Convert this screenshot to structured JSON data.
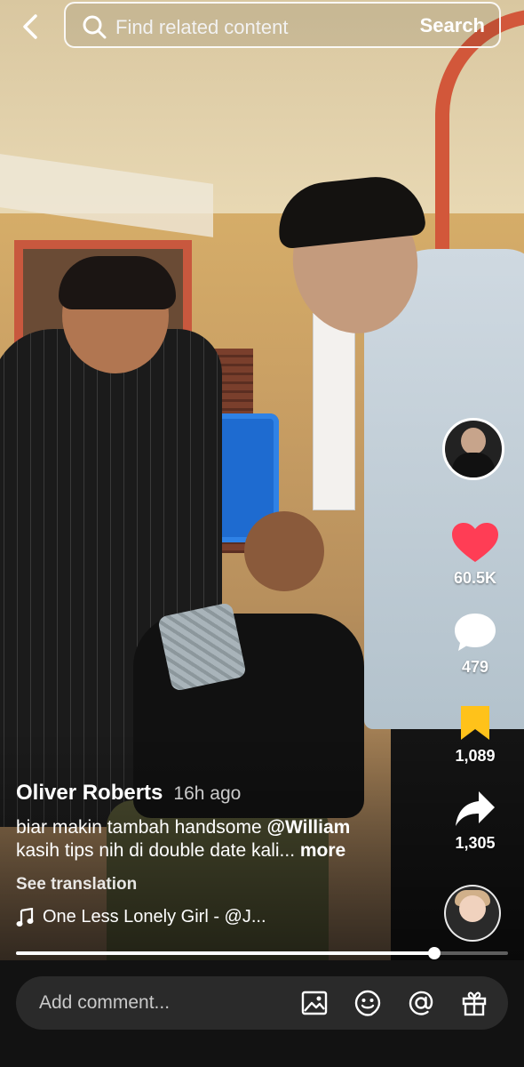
{
  "search": {
    "placeholder": "Find related content",
    "button": "Search"
  },
  "rail": {
    "likes": "60.5K",
    "comments": "479",
    "saves": "1,089",
    "shares": "1,305",
    "like_color": "#ff3d55",
    "save_color": "#ffc21a"
  },
  "caption": {
    "author": "Oliver Roberts",
    "time": "16h ago",
    "text_part1": "biar makin tambah handsome ",
    "mention": "@William",
    "text_part2": "kasih tips nih di double date kali... ",
    "more": "more",
    "see_translation": "See translation",
    "sound": "One Less Lonely Girl - @J..."
  },
  "progress": {
    "fraction": 0.85
  },
  "comment_bar": {
    "placeholder": "Add comment..."
  },
  "icons": {
    "back": "chevron-left-icon",
    "search": "search-icon",
    "like": "heart-icon",
    "comment": "comment-bubble-icon",
    "save": "bookmark-icon",
    "share": "share-arrow-icon",
    "music": "music-note-icon",
    "image": "image-icon",
    "emoji": "emoji-icon",
    "mention": "at-icon",
    "gift": "gift-icon"
  }
}
